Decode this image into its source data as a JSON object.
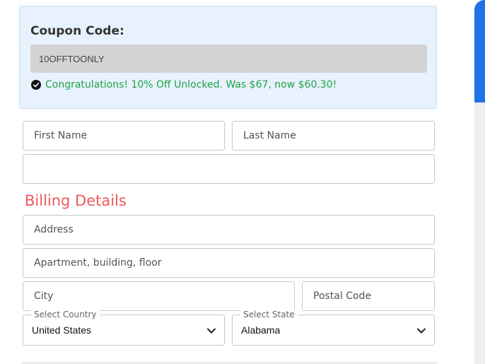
{
  "coupon": {
    "title": "Coupon Code:",
    "value": "10OFFTOONLY",
    "message": "Congratulations! 10% Off Unlocked. Was $67, now $60.30!"
  },
  "form": {
    "first_name_placeholder": "First Name",
    "last_name_placeholder": "Last Name",
    "email_placeholder": ""
  },
  "billing": {
    "title": "Billing Details",
    "address_placeholder": "Address",
    "apartment_placeholder": "Apartment, building, floor",
    "city_placeholder": "City",
    "postal_placeholder": "Postal Code",
    "country": {
      "label": "Select Country",
      "selected": "United States"
    },
    "state": {
      "label": "Select State",
      "selected": "Alabama"
    }
  },
  "colors": {
    "accent_blue": "#1e73e8",
    "success_green": "#1fa345",
    "billing_red": "#ef5a5a",
    "coupon_bg": "#e8f2fe"
  },
  "icons": {
    "success": "check-circle-icon",
    "dropdown": "chevron-down-icon"
  }
}
